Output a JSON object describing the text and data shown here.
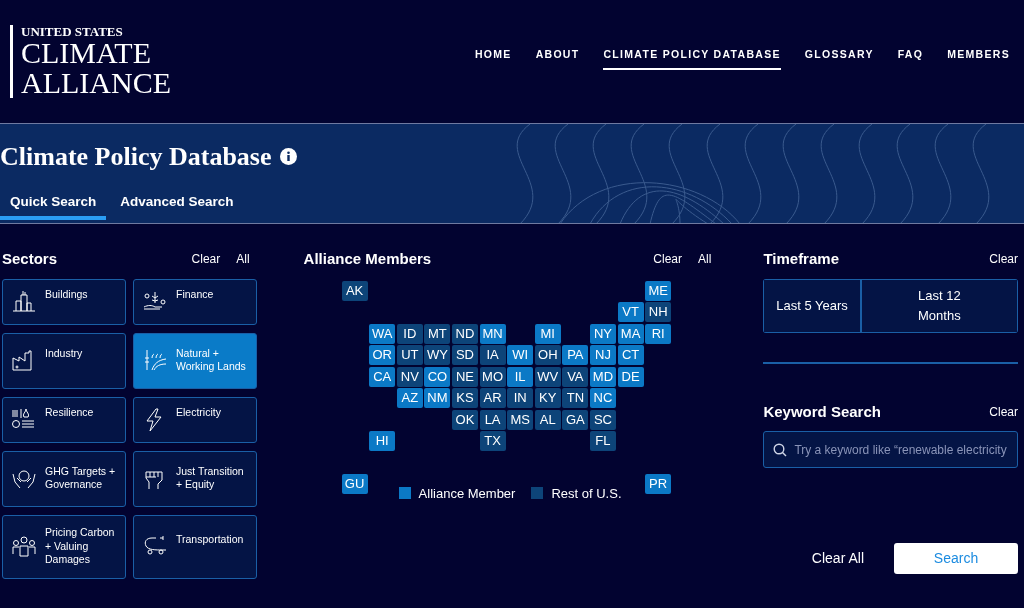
{
  "logo": {
    "line1": "UNITED STATES",
    "line2": "CLIMATE",
    "line3": "ALLIANCE"
  },
  "nav": [
    {
      "label": "HOME",
      "selected": false
    },
    {
      "label": "ABOUT",
      "selected": false
    },
    {
      "label": "CLIMATE POLICY DATABASE",
      "selected": true
    },
    {
      "label": "GLOSSARY",
      "selected": false
    },
    {
      "label": "FAQ",
      "selected": false
    },
    {
      "label": "MEMBERS",
      "selected": false
    }
  ],
  "banner": {
    "title": "Climate Policy Database",
    "tabs": [
      {
        "label": "Quick Search",
        "selected": true
      },
      {
        "label": "Advanced Search",
        "selected": false
      }
    ]
  },
  "sectors": {
    "title": "Sectors",
    "clear": "Clear",
    "all": "All",
    "items": [
      {
        "label": "Buildings",
        "selected": false
      },
      {
        "label": "Finance",
        "selected": false
      },
      {
        "label": "Industry",
        "selected": false
      },
      {
        "label": "Natural + Working Lands",
        "selected": true
      },
      {
        "label": "Resilience",
        "selected": false
      },
      {
        "label": "Electricity",
        "selected": false
      },
      {
        "label": "GHG Targets + Governance",
        "selected": false
      },
      {
        "label": "Just Transition + Equity",
        "selected": false
      },
      {
        "label": "Pricing Carbon + Valuing Damages",
        "selected": false
      },
      {
        "label": "Transportation",
        "selected": false
      }
    ]
  },
  "members": {
    "title": "Alliance Members",
    "clear": "Clear",
    "all": "All",
    "tiles": [
      {
        "label": "AK",
        "member": false
      },
      {
        "label": "ME",
        "member": true
      },
      {
        "label": "VT",
        "member": true
      },
      {
        "label": "NH",
        "member": false
      },
      {
        "label": "WA",
        "member": true
      },
      {
        "label": "ID",
        "member": false
      },
      {
        "label": "MT",
        "member": false
      },
      {
        "label": "ND",
        "member": false
      },
      {
        "label": "MN",
        "member": true
      },
      {
        "label": "MI",
        "member": true
      },
      {
        "label": "NY",
        "member": true
      },
      {
        "label": "MA",
        "member": true
      },
      {
        "label": "RI",
        "member": true
      },
      {
        "label": "OR",
        "member": true
      },
      {
        "label": "UT",
        "member": false
      },
      {
        "label": "WY",
        "member": false
      },
      {
        "label": "SD",
        "member": false
      },
      {
        "label": "IA",
        "member": false
      },
      {
        "label": "WI",
        "member": true
      },
      {
        "label": "OH",
        "member": false
      },
      {
        "label": "PA",
        "member": true
      },
      {
        "label": "NJ",
        "member": true
      },
      {
        "label": "CT",
        "member": true
      },
      {
        "label": "CA",
        "member": true
      },
      {
        "label": "NV",
        "member": false
      },
      {
        "label": "CO",
        "member": true
      },
      {
        "label": "NE",
        "member": false
      },
      {
        "label": "MO",
        "member": false
      },
      {
        "label": "IL",
        "member": true
      },
      {
        "label": "WV",
        "member": false
      },
      {
        "label": "VA",
        "member": false
      },
      {
        "label": "MD",
        "member": true
      },
      {
        "label": "DE",
        "member": true
      },
      {
        "label": "AZ",
        "member": true
      },
      {
        "label": "NM",
        "member": true
      },
      {
        "label": "KS",
        "member": false
      },
      {
        "label": "AR",
        "member": false
      },
      {
        "label": "IN",
        "member": false
      },
      {
        "label": "KY",
        "member": false
      },
      {
        "label": "TN",
        "member": false
      },
      {
        "label": "NC",
        "member": true
      },
      {
        "label": "OK",
        "member": false
      },
      {
        "label": "LA",
        "member": false
      },
      {
        "label": "MS",
        "member": false
      },
      {
        "label": "AL",
        "member": false
      },
      {
        "label": "GA",
        "member": false
      },
      {
        "label": "SC",
        "member": false
      },
      {
        "label": "HI",
        "member": true
      },
      {
        "label": "TX",
        "member": false
      },
      {
        "label": "FL",
        "member": false
      },
      {
        "label": "GU",
        "member": true
      },
      {
        "label": "PR",
        "member": true
      }
    ],
    "legend": [
      {
        "label": "Alliance Member",
        "member": true
      },
      {
        "label": "Rest of U.S.",
        "member": false
      }
    ]
  },
  "timeframe": {
    "title": "Timeframe",
    "clear": "Clear",
    "options": [
      {
        "label": "Last 5 Years",
        "selected": false
      },
      {
        "label": "Last 12 Months",
        "selected": false
      }
    ]
  },
  "keyword": {
    "title": "Keyword Search",
    "clear": "Clear",
    "placeholder": "Try a keyword like “renewable electricity"
  },
  "actions": {
    "clear_all": "Clear All",
    "search": "Search"
  }
}
